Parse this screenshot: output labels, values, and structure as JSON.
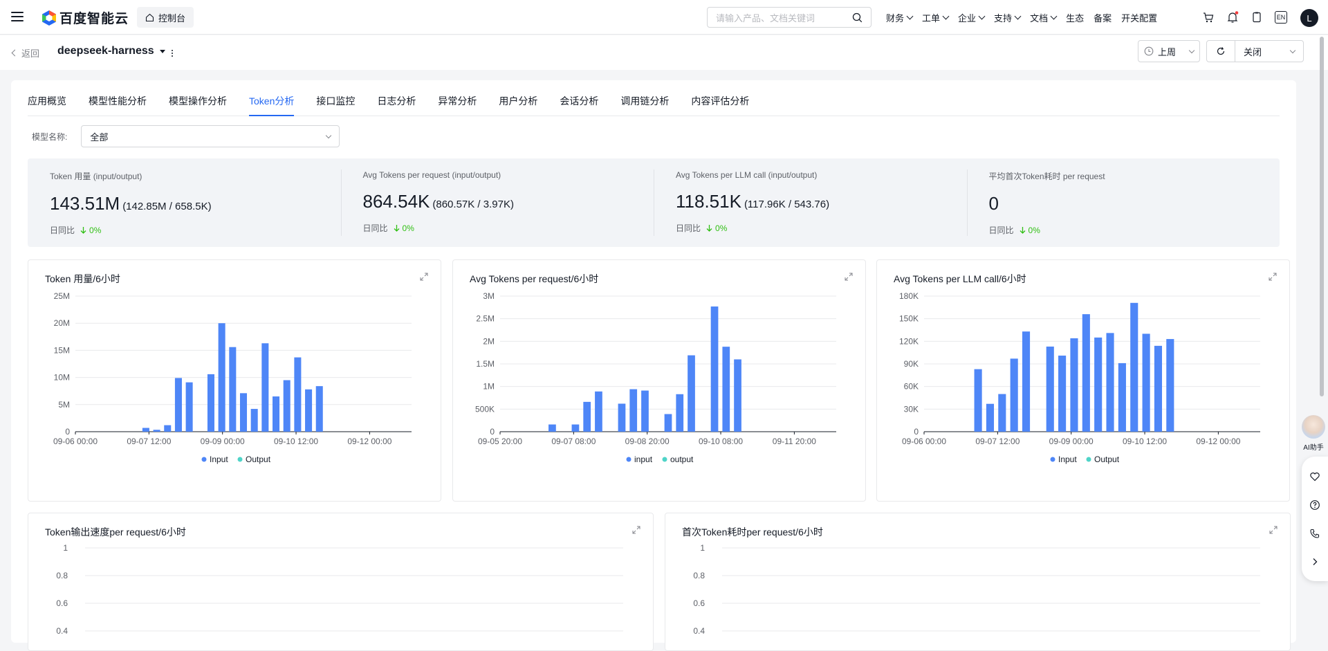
{
  "topbar": {
    "logo_text": "百度智能云",
    "console_label": "控制台",
    "search_placeholder": "请输入产品、文档关键词",
    "nav": [
      {
        "label": "财务",
        "dropdown": true
      },
      {
        "label": "工单",
        "dropdown": true
      },
      {
        "label": "企业",
        "dropdown": true
      },
      {
        "label": "支持",
        "dropdown": true
      },
      {
        "label": "文档",
        "dropdown": true
      },
      {
        "label": "生态",
        "dropdown": false
      },
      {
        "label": "备案",
        "dropdown": false
      },
      {
        "label": "开关配置",
        "dropdown": false
      }
    ],
    "lang": "EN",
    "avatar_letter": "L",
    "icons": [
      "cart-icon",
      "bell-icon",
      "clipboard-icon",
      "language-icon"
    ]
  },
  "subbar": {
    "back_label": "返回",
    "app_name": "deepseek-harness",
    "time_range": "上周",
    "refresh_option": "关闭"
  },
  "tabs": [
    {
      "label": "应用概览",
      "active": false
    },
    {
      "label": "模型性能分析",
      "active": false
    },
    {
      "label": "模型操作分析",
      "active": false
    },
    {
      "label": "Token分析",
      "active": true
    },
    {
      "label": "接口监控",
      "active": false
    },
    {
      "label": "日志分析",
      "active": false
    },
    {
      "label": "异常分析",
      "active": false
    },
    {
      "label": "用户分析",
      "active": false
    },
    {
      "label": "会话分析",
      "active": false
    },
    {
      "label": "调用链分析",
      "active": false
    },
    {
      "label": "内容评估分析",
      "active": false
    }
  ],
  "filter": {
    "label": "模型名称:",
    "value": "全部"
  },
  "stats": [
    {
      "label": "Token 用量 (input/output)",
      "big": "143.51M",
      "small": "(142.85M / 658.5K)",
      "cmp_label": "日同比",
      "cmp_value": "0%"
    },
    {
      "label": "Avg Tokens per request (input/output)",
      "big": "864.54K",
      "small": "(860.57K / 3.97K)",
      "cmp_label": "日同比",
      "cmp_value": "0%"
    },
    {
      "label": "Avg Tokens per LLM call (input/output)",
      "big": "118.51K",
      "small": "(117.96K / 543.76)",
      "cmp_label": "日同比",
      "cmp_value": "0%"
    },
    {
      "label": "平均首次Token耗时 per request",
      "big": "0",
      "small": "",
      "cmp_label": "日同比",
      "cmp_value": "0%"
    }
  ],
  "colors": {
    "accent": "#2468f2",
    "input_series": "#4e86f7",
    "output_series": "#4fd4c8",
    "up_down": "#30bf13"
  },
  "charts": [
    {
      "title": "Token 用量/6小时",
      "legend": [
        "Input",
        "Output"
      ],
      "yticks": [
        "0",
        "5M",
        "10M",
        "15M",
        "20M",
        "25M"
      ],
      "xticks": [
        "09-06 00:00",
        "09-07 12:00",
        "09-09 00:00",
        "09-10 12:00",
        "09-12 00:00"
      ]
    },
    {
      "title": "Avg Tokens per request/6小时",
      "legend": [
        "input",
        "output"
      ],
      "yticks": [
        "0",
        "500K",
        "1M",
        "1.5M",
        "2M",
        "2.5M",
        "3M"
      ],
      "xticks": [
        "09-05 20:00",
        "09-07 08:00",
        "09-08 20:00",
        "09-10 08:00",
        "09-11 20:00"
      ]
    },
    {
      "title": "Avg Tokens per LLM call/6小时",
      "legend": [
        "Input",
        "Output"
      ],
      "yticks": [
        "0",
        "30K",
        "60K",
        "90K",
        "120K",
        "150K",
        "180K"
      ],
      "xticks": [
        "09-06 00:00",
        "09-07 12:00",
        "09-09 00:00",
        "09-10 12:00",
        "09-12 00:00"
      ]
    },
    {
      "title": "Token输出速度per request/6小时",
      "yticks": [
        "0.4",
        "0.6",
        "0.8",
        "1"
      ]
    },
    {
      "title": "首次Token耗时per request/6小时",
      "yticks": [
        "0.4",
        "0.6",
        "0.8",
        "1"
      ]
    }
  ],
  "chart_data": [
    {
      "type": "bar",
      "title": "Token 用量/6小时",
      "ylim": [
        0,
        25000000
      ],
      "series": [
        {
          "name": "Input",
          "values": [
            0,
            0,
            0,
            0,
            0,
            0,
            0,
            0,
            0,
            0,
            0,
            0,
            0,
            0,
            0,
            0,
            0,
            0,
            0,
            0,
            0,
            0,
            0,
            0,
            0,
            0,
            0,
            0,
            0,
            0,
            0,
            0,
            0,
            0,
            0,
            0,
            0,
            0,
            0,
            0,
            0,
            0,
            0,
            0,
            0,
            0,
            0,
            0,
            0,
            0,
            0,
            0,
            0,
            0,
            0,
            0,
            0,
            0,
            0,
            0,
            0,
            0,
            0,
            0,
            0,
            0,
            0,
            0,
            0,
            0,
            0,
            0,
            0,
            0,
            0,
            0,
            0,
            0,
            0,
            0,
            0,
            0,
            0,
            0,
            0,
            0,
            0,
            0,
            0,
            0,
            0,
            0,
            0,
            0,
            0,
            0,
            0,
            0,
            0,
            0
          ]
        },
        {
          "name": "Output",
          "values": [
            0
          ]
        }
      ],
      "bars": [
        {
          "slot": 6,
          "value": 700000
        },
        {
          "slot": 7,
          "value": 350000
        },
        {
          "slot": 8,
          "value": 1200000
        },
        {
          "slot": 9,
          "value": 9900000
        },
        {
          "slot": 10,
          "value": 9100000
        },
        {
          "slot": 12,
          "value": 10600000
        },
        {
          "slot": 13,
          "value": 20000000
        },
        {
          "slot": 14,
          "value": 15600000
        },
        {
          "slot": 15,
          "value": 7100000
        },
        {
          "slot": 16,
          "value": 4200000
        },
        {
          "slot": 17,
          "value": 16300000
        },
        {
          "slot": 18,
          "value": 6500000
        },
        {
          "slot": 19,
          "value": 9500000
        },
        {
          "slot": 20,
          "value": 13700000
        },
        {
          "slot": 21,
          "value": 7800000
        },
        {
          "slot": 22,
          "value": 8400000
        }
      ],
      "slots": 31
    },
    {
      "type": "bar",
      "title": "Avg Tokens per request/6小时",
      "ylim": [
        0,
        3000000
      ],
      "series": [
        {
          "name": "input"
        },
        {
          "name": "output"
        }
      ],
      "bars": [
        {
          "slot": 4,
          "value": 160000
        },
        {
          "slot": 6,
          "value": 160000
        },
        {
          "slot": 7,
          "value": 660000
        },
        {
          "slot": 8,
          "value": 890000
        },
        {
          "slot": 10,
          "value": 620000
        },
        {
          "slot": 11,
          "value": 940000
        },
        {
          "slot": 12,
          "value": 910000
        },
        {
          "slot": 14,
          "value": 390000
        },
        {
          "slot": 15,
          "value": 830000
        },
        {
          "slot": 16,
          "value": 1690000
        },
        {
          "slot": 18,
          "value": 2770000
        },
        {
          "slot": 19,
          "value": 1880000
        },
        {
          "slot": 20,
          "value": 1600000
        }
      ],
      "slots": 29
    },
    {
      "type": "bar",
      "title": "Avg Tokens per LLM call/6小时",
      "ylim": [
        0,
        180000
      ],
      "series": [
        {
          "name": "Input"
        },
        {
          "name": "Output"
        }
      ],
      "bars": [
        {
          "slot": 4,
          "value": 83000
        },
        {
          "slot": 5,
          "value": 37000
        },
        {
          "slot": 6,
          "value": 50000
        },
        {
          "slot": 7,
          "value": 97000
        },
        {
          "slot": 8,
          "value": 133000
        },
        {
          "slot": 10,
          "value": 113000
        },
        {
          "slot": 11,
          "value": 101000
        },
        {
          "slot": 12,
          "value": 124000
        },
        {
          "slot": 13,
          "value": 156000
        },
        {
          "slot": 14,
          "value": 125000
        },
        {
          "slot": 15,
          "value": 131000
        },
        {
          "slot": 16,
          "value": 91000
        },
        {
          "slot": 17,
          "value": 171000
        },
        {
          "slot": 18,
          "value": 130000
        },
        {
          "slot": 19,
          "value": 114000
        },
        {
          "slot": 20,
          "value": 123000
        }
      ],
      "slots": 28
    },
    {
      "type": "line",
      "title": "Token输出速度per request/6小时",
      "ylim": [
        0,
        1
      ],
      "series": []
    },
    {
      "type": "line",
      "title": "首次Token耗时per request/6小时",
      "ylim": [
        0,
        1
      ],
      "series": []
    }
  ],
  "assistant_label": "AI助手"
}
